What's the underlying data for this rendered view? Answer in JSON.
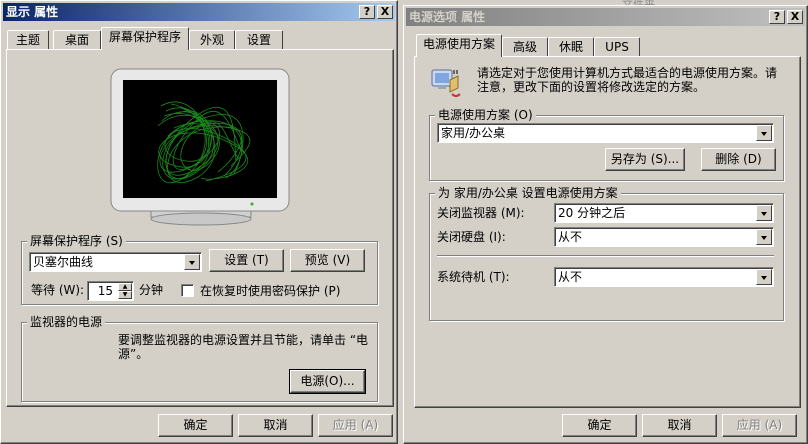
{
  "display_window": {
    "title": "显示 属性",
    "help_btn": "?",
    "close_btn": "X",
    "tabs": [
      "主题",
      "桌面",
      "屏幕保护程序",
      "外观",
      "设置"
    ],
    "screensaver_group": {
      "label": "屏幕保护程序 (S)",
      "selected": "贝塞尔曲线",
      "settings_btn": "设置 (T)",
      "preview_btn": "预览 (V)",
      "wait_label": "等待 (W):",
      "wait_value": "15",
      "minutes": "分钟",
      "password_label": "在恢复时使用密码保护 (P)",
      "password_checked": false
    },
    "power_group": {
      "label": "监视器的电源",
      "description_line1": "要调整监视器的电源设置并且节能，请单击 “电",
      "description_line2": "源”。",
      "power_btn": "电源(O)..."
    },
    "footer": {
      "ok": "确定",
      "cancel": "取消",
      "apply": "应用 (A)"
    }
  },
  "power_window": {
    "title": "电源选项 属性",
    "help_btn": "?",
    "close_btn": "X",
    "tabs": [
      "电源使用方案",
      "高级",
      "休眠",
      "UPS"
    ],
    "intro_line1": "请选定对于您使用计算机方式最适合的电源使用方案。请",
    "intro_line2": "注意，更改下面的设置将修改选定的方案。",
    "scheme_group": {
      "label": "电源使用方案 (O)",
      "selected": "家用/办公桌",
      "save_as_btn": "另存为 (S)...",
      "delete_btn": "删除 (D)"
    },
    "settings_group": {
      "label": "为 家用/办公桌 设置电源使用方案",
      "monitor_label": "关闭监视器 (M):",
      "monitor_value": "20 分钟之后",
      "disk_label": "关闭硬盘 (I):",
      "disk_value": "从不",
      "standby_label": "系统待机 (T):",
      "standby_value": "从不"
    },
    "footer": {
      "ok": "确定",
      "cancel": "取消",
      "apply": "应用 (A)"
    }
  },
  "background_text": "文件夹..."
}
